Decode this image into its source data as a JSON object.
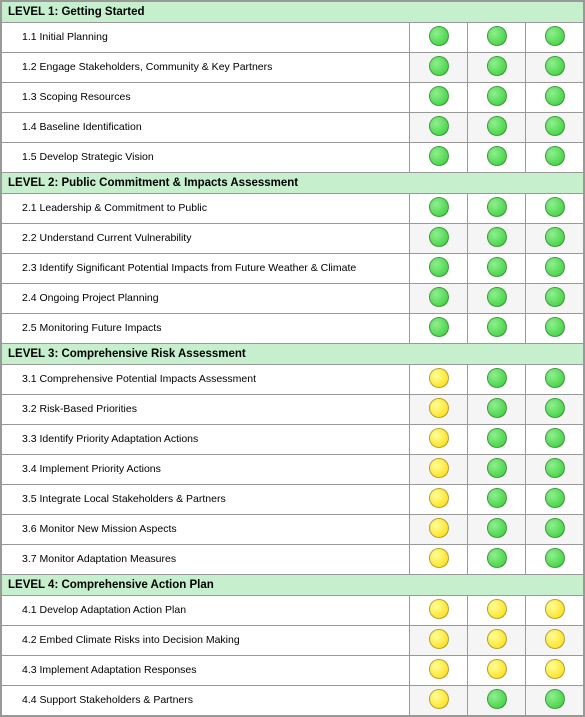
{
  "levels": [
    {
      "id": "level1",
      "header": "LEVEL 1:  Getting Started",
      "items": [
        {
          "label": "1.1 Initial Planning",
          "dots": [
            "green",
            "green",
            "green"
          ]
        },
        {
          "label": "1.2 Engage Stakeholders, Community & Key Partners",
          "dots": [
            "green",
            "green",
            "green"
          ]
        },
        {
          "label": "1.3 Scoping Resources",
          "dots": [
            "green",
            "green",
            "green"
          ]
        },
        {
          "label": "1.4 Baseline Identification",
          "dots": [
            "green",
            "green",
            "green"
          ]
        },
        {
          "label": "1.5 Develop Strategic Vision",
          "dots": [
            "green",
            "green",
            "green"
          ]
        }
      ]
    },
    {
      "id": "level2",
      "header": "LEVEL 2:  Public Commitment & Impacts Assessment",
      "items": [
        {
          "label": "2.1 Leadership & Commitment to Public",
          "dots": [
            "green",
            "green",
            "green"
          ]
        },
        {
          "label": "2.2 Understand Current Vulnerability",
          "dots": [
            "green",
            "green",
            "green"
          ]
        },
        {
          "label": "2.3 Identify Significant Potential Impacts from Future Weather & Climate",
          "dots": [
            "green",
            "green",
            "green"
          ]
        },
        {
          "label": "2.4 Ongoing Project Planning",
          "dots": [
            "green",
            "green",
            "green"
          ]
        },
        {
          "label": "2.5 Monitoring Future Impacts",
          "dots": [
            "green",
            "green",
            "green"
          ]
        }
      ]
    },
    {
      "id": "level3",
      "header": "LEVEL 3:  Comprehensive Risk Assessment",
      "items": [
        {
          "label": "3.1 Comprehensive Potential Impacts Assessment",
          "dots": [
            "yellow",
            "green",
            "green"
          ]
        },
        {
          "label": "3.2 Risk-Based Priorities",
          "dots": [
            "yellow",
            "green",
            "green"
          ]
        },
        {
          "label": "3.3 Identify Priority Adaptation Actions",
          "dots": [
            "yellow",
            "green",
            "green"
          ]
        },
        {
          "label": "3.4 Implement Priority Actions",
          "dots": [
            "yellow",
            "green",
            "green"
          ]
        },
        {
          "label": "3.5 Integrate Local Stakeholders & Partners",
          "dots": [
            "yellow",
            "green",
            "green"
          ]
        },
        {
          "label": "3.6 Monitor New Mission Aspects",
          "dots": [
            "yellow",
            "green",
            "green"
          ]
        },
        {
          "label": "3.7 Monitor Adaptation Measures",
          "dots": [
            "yellow",
            "green",
            "green"
          ]
        }
      ]
    },
    {
      "id": "level4",
      "header": "LEVEL 4:  Comprehensive Action Plan",
      "items": [
        {
          "label": "4.1 Develop Adaptation Action Plan",
          "dots": [
            "yellow",
            "yellow",
            "yellow"
          ]
        },
        {
          "label": "4.2 Embed Climate Risks into Decision Making",
          "dots": [
            "yellow",
            "yellow",
            "yellow"
          ]
        },
        {
          "label": "4.3 Implement Adaptation Responses",
          "dots": [
            "yellow",
            "yellow",
            "yellow"
          ]
        },
        {
          "label": "4.4 Support Stakeholders & Partners",
          "dots": [
            "yellow",
            "green",
            "green"
          ]
        }
      ]
    }
  ]
}
